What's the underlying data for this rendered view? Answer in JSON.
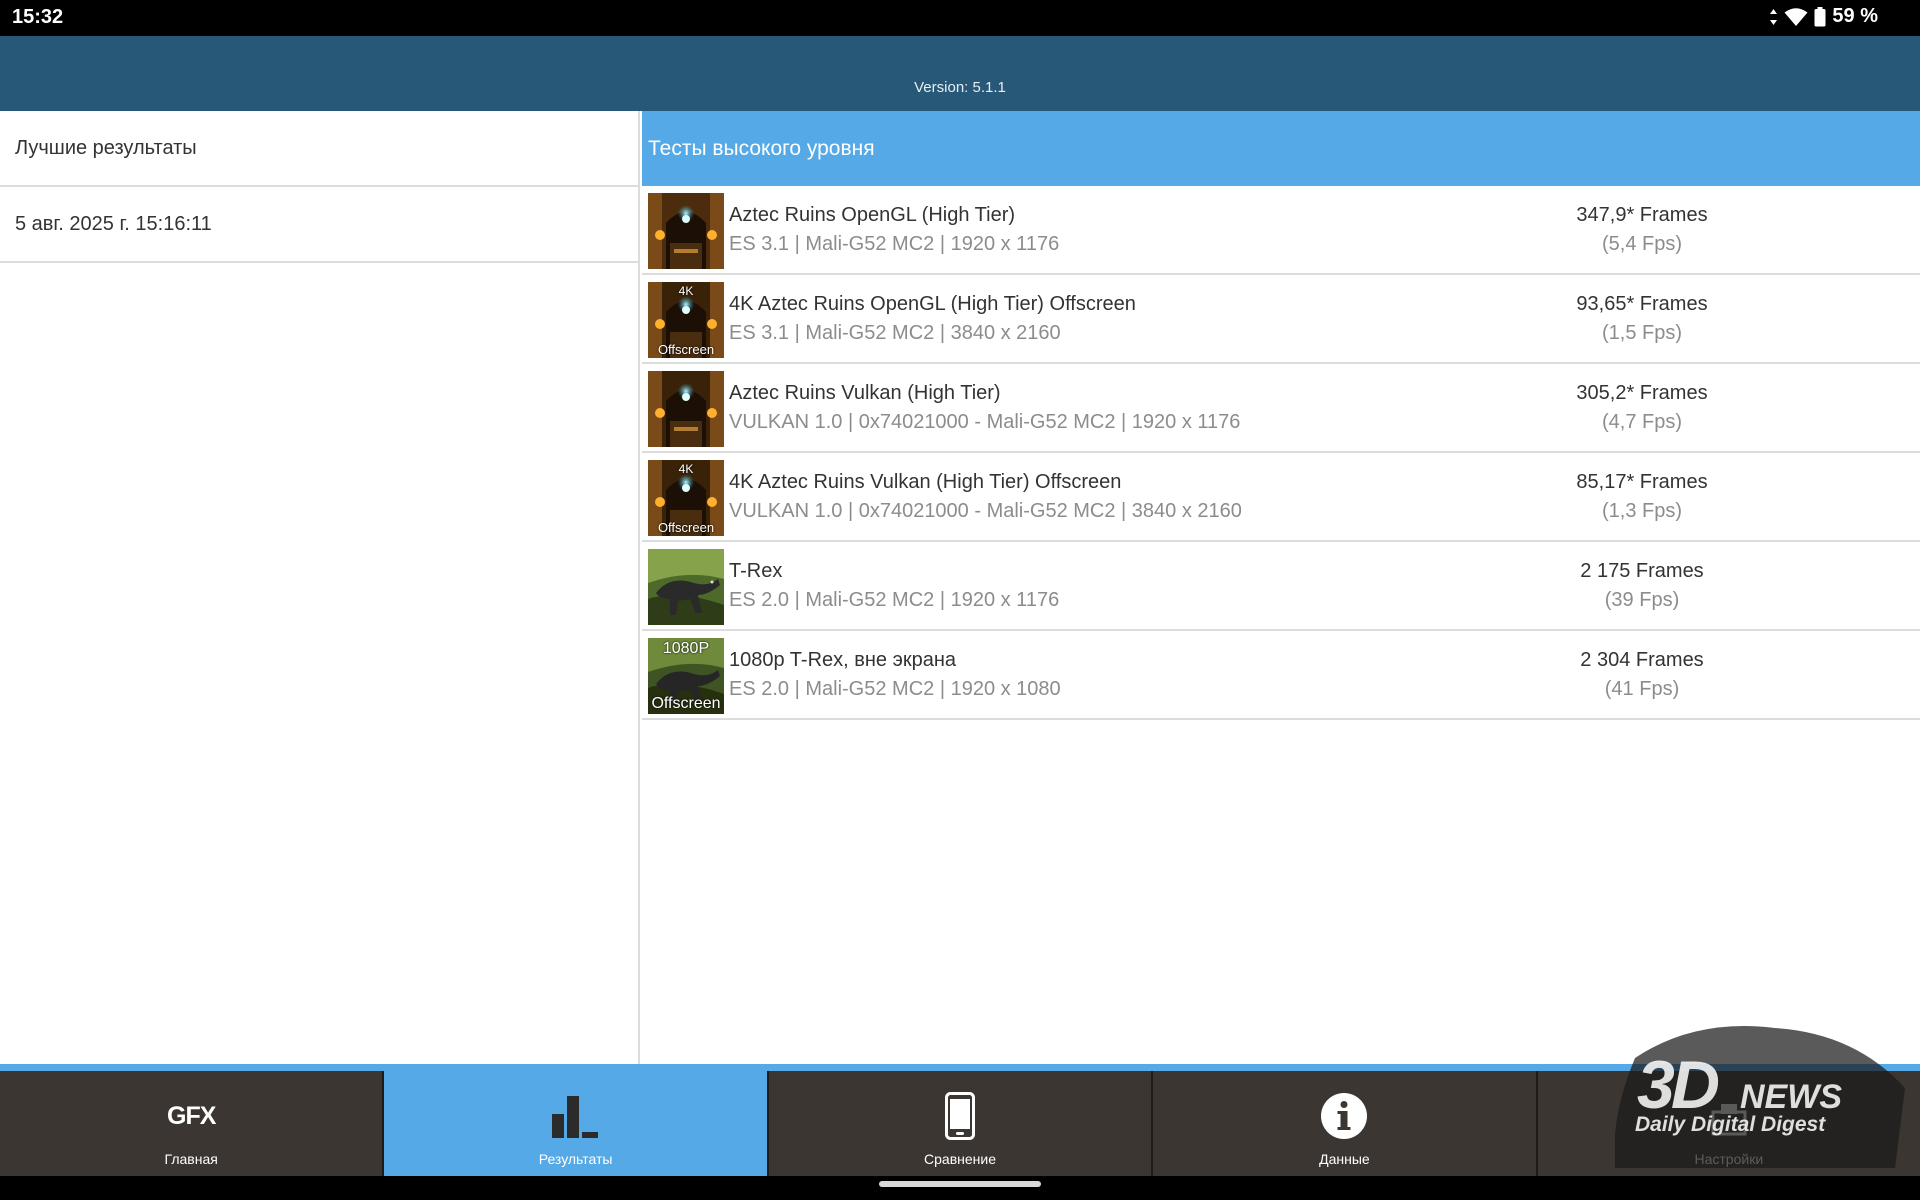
{
  "status_bar": {
    "time": "15:32",
    "battery": "59 %"
  },
  "header": {
    "version": "Version: 5.1.1"
  },
  "left_panel": {
    "items": [
      {
        "label": "Лучшие результаты"
      },
      {
        "label": "5 авг. 2025 г. 15:16:11"
      }
    ]
  },
  "right_panel": {
    "section_title": "Тесты высокого уровня",
    "results": [
      {
        "title": "Aztec Ruins OpenGL (High Tier)",
        "subtitle": "ES 3.1 | Mali-G52 MC2 | 1920 x 1176",
        "score": "347,9* Frames",
        "fps": "(5,4 Fps)",
        "tag_top": "",
        "tag_bottom": ""
      },
      {
        "title": "4K Aztec Ruins OpenGL (High Tier) Offscreen",
        "subtitle": "ES 3.1 | Mali-G52 MC2 | 3840 x 2160",
        "score": "93,65* Frames",
        "fps": "(1,5 Fps)",
        "tag_top": "4K",
        "tag_bottom": "Offscreen"
      },
      {
        "title": "Aztec Ruins Vulkan (High Tier)",
        "subtitle": "VULKAN 1.0 | 0x74021000 - Mali-G52 MC2 | 1920 x 1176",
        "score": "305,2* Frames",
        "fps": "(4,7 Fps)",
        "tag_top": "",
        "tag_bottom": ""
      },
      {
        "title": "4K Aztec Ruins Vulkan (High Tier) Offscreen",
        "subtitle": "VULKAN 1.0 | 0x74021000 - Mali-G52 MC2 | 3840 x 2160",
        "score": "85,17* Frames",
        "fps": "(1,3 Fps)",
        "tag_top": "4K",
        "tag_bottom": "Offscreen"
      },
      {
        "title": "T-Rex",
        "subtitle": "ES 2.0 | Mali-G52 MC2 | 1920 x 1176",
        "score": "2 175 Frames",
        "fps": "(39 Fps)",
        "tag_top": "",
        "tag_bottom": ""
      },
      {
        "title": "1080p T-Rex, вне экрана",
        "subtitle": "ES 2.0 | Mali-G52 MC2 | 1920 x 1080",
        "score": "2 304 Frames",
        "fps": "(41 Fps)",
        "tag_top": "1080P",
        "tag_bottom": "Offscreen"
      }
    ]
  },
  "bottom_nav": {
    "gfx_logo": "GFX",
    "items": [
      {
        "label": "Главная",
        "icon": "gfx-logo-icon"
      },
      {
        "label": "Результаты",
        "icon": "bar-chart-icon"
      },
      {
        "label": "Сравнение",
        "icon": "phone-icon"
      },
      {
        "label": "Данные",
        "icon": "info-icon"
      },
      {
        "label": "Настройки",
        "icon": "settings-icon"
      }
    ],
    "active_index": 1
  },
  "watermark": {
    "logo": "3D",
    "brand": "NEWS",
    "tagline": "Daily Digital Digest"
  },
  "colors": {
    "header": "#285878",
    "accent": "#54a9e6",
    "nav_background": "#3b3631",
    "status_bar": "#000000"
  }
}
